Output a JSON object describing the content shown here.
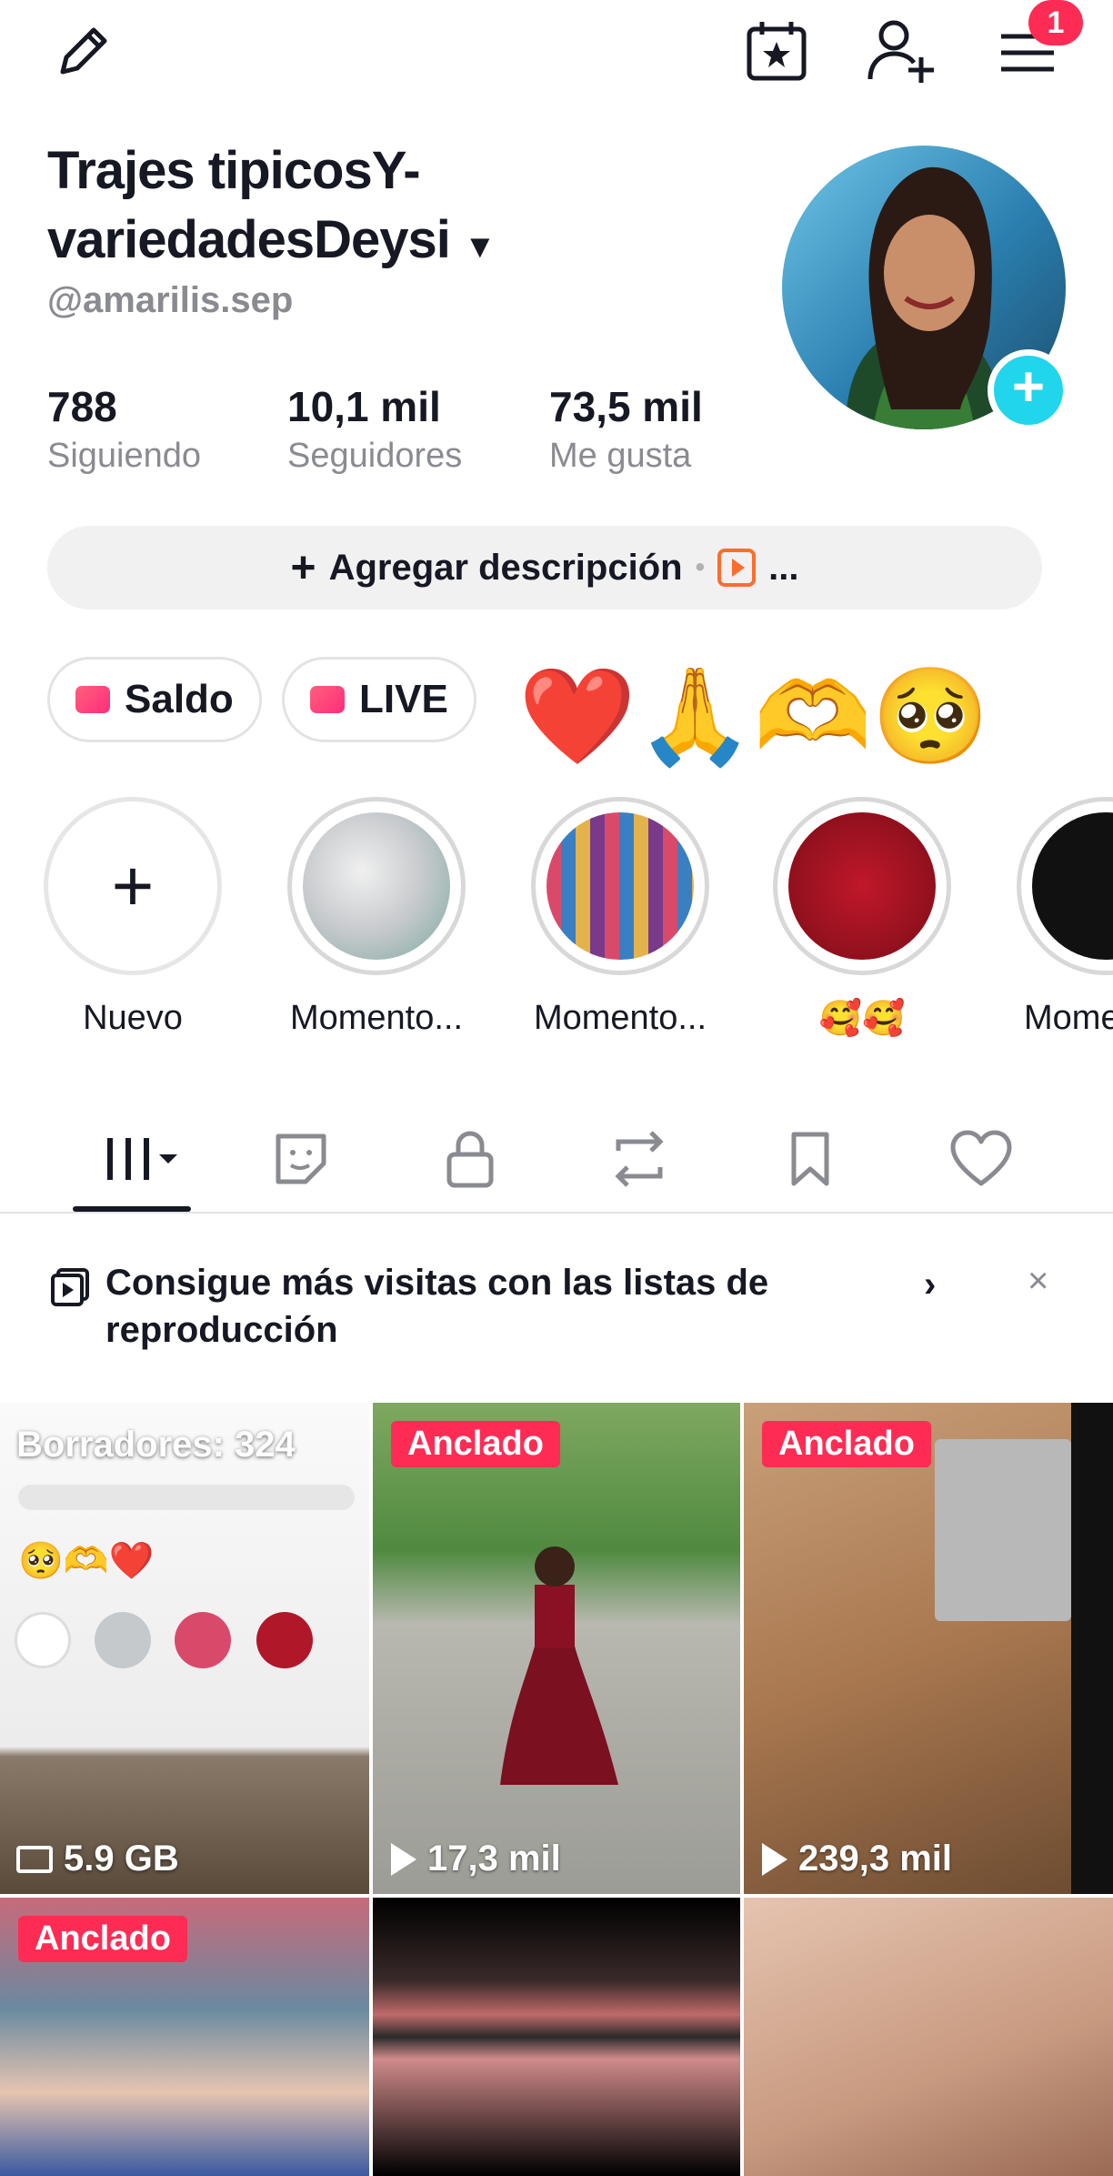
{
  "header": {
    "notification_count": "1"
  },
  "profile": {
    "name": "Trajes tipicosY-variedadesDeysi",
    "handle": "@amarilis.sep",
    "stats": [
      {
        "value": "788",
        "label": "Siguiendo"
      },
      {
        "value": "10,1 mil",
        "label": "Seguidores"
      },
      {
        "value": "73,5 mil",
        "label": "Me gusta"
      }
    ],
    "add_description": "Agregar descripción",
    "more": "..."
  },
  "pills": {
    "balance": "Saldo",
    "live": "LIVE",
    "emojis": "❤️🙏🫶🥺"
  },
  "highlights": [
    {
      "label": "Nuevo"
    },
    {
      "label": "Momento..."
    },
    {
      "label": "Momento..."
    },
    {
      "label": "🥰🥰"
    },
    {
      "label": "Mome"
    }
  ],
  "tabs": [
    {
      "icon": "grid-icon"
    },
    {
      "icon": "sticker-icon"
    },
    {
      "icon": "lock-icon"
    },
    {
      "icon": "repost-icon"
    },
    {
      "icon": "bookmark-icon"
    },
    {
      "icon": "heart-icon"
    }
  ],
  "promo": {
    "text": "Consigue más visitas con las listas de reproducción"
  },
  "videos": {
    "drafts": "Borradores: 324",
    "storage": "5.9 GB",
    "pinned_label": "Anclado",
    "v2_views": "17,3 mil",
    "v3_views": "239,3 mil"
  },
  "colors": {
    "accent": "#fe2c55",
    "avatar_add": "#20d5ec",
    "muted": "#8a8b91"
  }
}
